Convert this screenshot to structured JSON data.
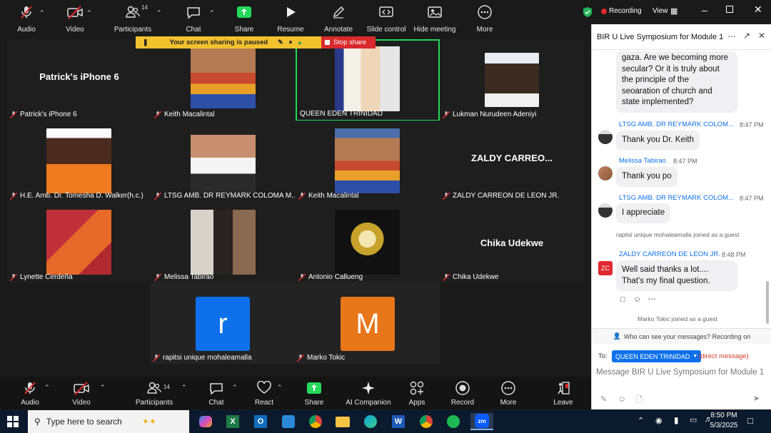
{
  "top_toolbar": {
    "audio": "Audio",
    "video": "Video",
    "participants": "Participants",
    "participants_count": "14",
    "chat": "Chat",
    "share": "Share",
    "resume": "Resume",
    "annotate": "Annotate",
    "slide_control": "Slide control",
    "hide_meeting": "Hide meeting",
    "more": "More"
  },
  "window": {
    "recording": "Recording",
    "view": "View"
  },
  "share_bar": {
    "paused": "Your screen sharing is paused",
    "stop": "Stop share"
  },
  "tiles": [
    {
      "label": "Patrick's iPhone 6",
      "big": "Patrick's iPhone 6"
    },
    {
      "label": "Keith Macalintal"
    },
    {
      "label": "QUEEN EDEN TRINIDAD"
    },
    {
      "label": "Lukman Nurudeen Adeniyi"
    },
    {
      "label": "H.E. Amb. Dr. Tomesha D. Walker(h.c.)"
    },
    {
      "label": "LTSG AMB. DR REYMARK COLOMA M..."
    },
    {
      "label": "Keith Macalintal"
    },
    {
      "label": "ZALDY CARREON DE LEON JR.",
      "big": "ZALDY  CARREO..."
    },
    {
      "label": "Lynette Cerdeña"
    },
    {
      "label": "Melissa Tabirao"
    },
    {
      "label": "Antonio Callueng"
    },
    {
      "label": "Chika Udekwe",
      "big": "Chika Udekwe"
    },
    {
      "label": "rapitsi unique mohaleamalla",
      "letter": "r"
    },
    {
      "label": "Marko Tokic",
      "letter": "M"
    }
  ],
  "bottom_toolbar": {
    "audio": "Audio",
    "video": "Video",
    "participants": "Participants",
    "participants_count": "14",
    "chat": "Chat",
    "react": "React",
    "share": "Share",
    "ai": "AI Companion",
    "apps": "Apps",
    "record": "Record",
    "more": "More",
    "leave": "Leave"
  },
  "chat": {
    "title": "BIR U Live Symposium for Module 1",
    "first_bubble": [
      "gaza. Are we becoming more",
      "secular? Or it is truly about",
      "the principle of the",
      "seoaration of church and",
      "state implemented?"
    ],
    "messages": [
      {
        "sender": "LTSG AMB. DR REYMARK COLOM...",
        "time": "8:47 PM",
        "text": "Thank you Dr. Keith"
      },
      {
        "sender": "Melissa Tabirao",
        "time": "8:47 PM",
        "text": "Thank you po"
      },
      {
        "sender": "LTSG AMB. DR REYMARK COLOM...",
        "time": "8:47 PM",
        "text": "I appreciate"
      }
    ],
    "joined1": "rapitsi unique mohaleamalla joined as a guest",
    "zaldy": {
      "sender": "ZALDY CARREON DE LEON JR.",
      "time": "8:48 PM",
      "initials": "ZC",
      "lines": [
        "Well said  thanks a lot....",
        "That's my final question."
      ]
    },
    "joined2": "Marko Tokic joined as a guest",
    "who_can_see": "Who can see your messages? Recording on",
    "to_label": "To:",
    "recipient": "QUEEN EDEN TRINIDAD",
    "direct": "(direct message)",
    "placeholder": "Message BIR U Live Symposium for Module 1"
  },
  "taskbar": {
    "search": "Type here to search",
    "time": "8:50 PM",
    "date": "5/3/2025"
  },
  "colors": {
    "accent": "#0e71eb",
    "red": "#e0282e",
    "green": "#23d959",
    "pause": "#f2c12e"
  }
}
